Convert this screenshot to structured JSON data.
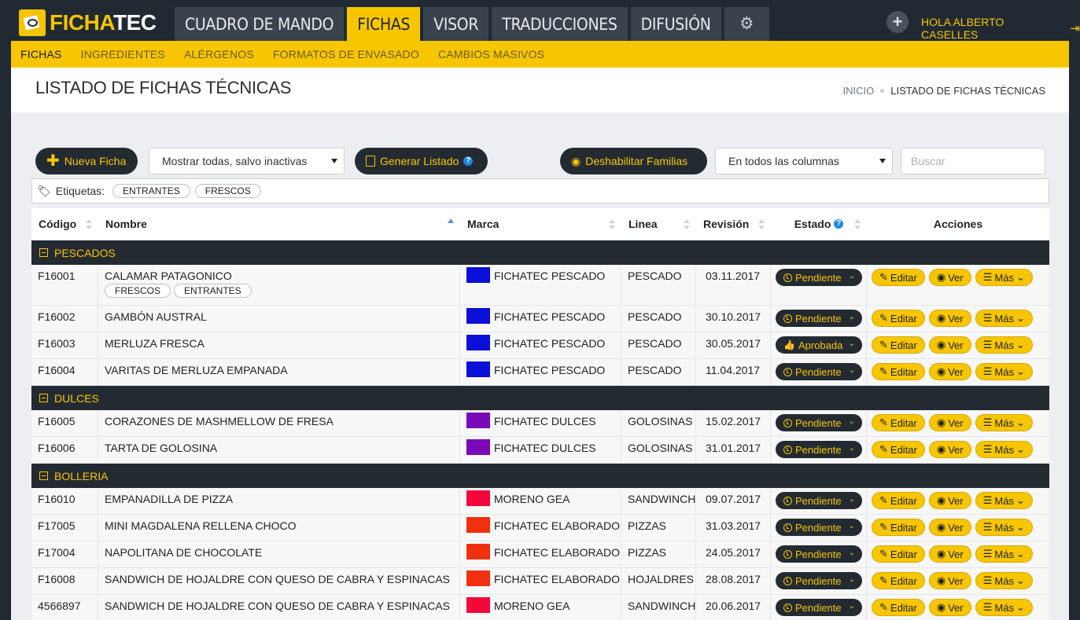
{
  "app": {
    "logo_a": "FICHA",
    "logo_b": "TEC"
  },
  "main_tabs": [
    {
      "label": "CUADRO DE MANDO"
    },
    {
      "label": "FICHAS"
    },
    {
      "label": "VISOR"
    },
    {
      "label": "TRADUCCIONES"
    },
    {
      "label": "DIFUSIÓN"
    }
  ],
  "greeting": "HOLA ALBERTO CASELLES",
  "subnav": [
    {
      "label": "FICHAS"
    },
    {
      "label": "INGREDIENTES"
    },
    {
      "label": "ALÉRGENOS"
    },
    {
      "label": "FORMATOS DE ENVASADO"
    },
    {
      "label": "CAMBIOS MASIVOS"
    }
  ],
  "page": {
    "title": "LISTADO DE FICHAS TÉCNICAS",
    "crumb_home": "INICIO",
    "crumb_current": "LISTADO DE FICHAS TÉCNICAS"
  },
  "toolbar": {
    "new_label": "Nueva Ficha",
    "filter_value": "Mostrar todas, salvo inactivas",
    "generate_label": "Generar Listado",
    "disable_families_label": "Deshabilitar Familias",
    "columns_value": "En todos las columnas",
    "search_placeholder": "Buscar"
  },
  "tags": {
    "label": "Etiquetas:",
    "items": [
      "ENTRANTES",
      "FRESCOS"
    ]
  },
  "columns": [
    "Código",
    "Nombre",
    "Marca",
    "Linea",
    "Revisión",
    "Estado",
    "Acciones"
  ],
  "actions": {
    "edit": "Editar",
    "view": "Ver",
    "more": "Más"
  },
  "colors": {
    "accent": "#f7c600",
    "dark": "#232a31"
  },
  "groups": [
    {
      "name": "PESCADOS",
      "rows": [
        {
          "code": "F16001",
          "name": "CALAMAR PATAGONICO",
          "tags": [
            "FRESCOS",
            "ENTRANTES"
          ],
          "brand": "FICHATEC PESCADO",
          "brand_color": "#0a10d8",
          "line": "PESCADO",
          "date": "03.11.2017",
          "status": "Pendiente"
        },
        {
          "code": "F16002",
          "name": "GAMBÓN AUSTRAL",
          "tags": [],
          "brand": "FICHATEC PESCADO",
          "brand_color": "#0a10d8",
          "line": "PESCADO",
          "date": "30.10.2017",
          "status": "Pendiente"
        },
        {
          "code": "F16003",
          "name": "MERLUZA FRESCA",
          "tags": [],
          "brand": "FICHATEC PESCADO",
          "brand_color": "#0a10d8",
          "line": "PESCADO",
          "date": "30.05.2017",
          "status": "Aprobada"
        },
        {
          "code": "F16004",
          "name": "VARITAS DE MERLUZA EMPANADA",
          "tags": [],
          "brand": "FICHATEC PESCADO",
          "brand_color": "#0a10d8",
          "line": "PESCADO",
          "date": "11.04.2017",
          "status": "Pendiente"
        }
      ]
    },
    {
      "name": "DULCES",
      "rows": [
        {
          "code": "F16005",
          "name": "CORAZONES DE MASHMELLOW DE FRESA",
          "tags": [],
          "brand": "FICHATEC DULCES",
          "brand_color": "#7a0ab8",
          "line": "GOLOSINAS",
          "date": "15.02.2017",
          "status": "Pendiente"
        },
        {
          "code": "F16006",
          "name": "TARTA DE GOLOSINA",
          "tags": [],
          "brand": "FICHATEC DULCES",
          "brand_color": "#7a0ab8",
          "line": "GOLOSINAS",
          "date": "31.01.2017",
          "status": "Pendiente"
        }
      ]
    },
    {
      "name": "BOLLERIA",
      "rows": [
        {
          "code": "F16010",
          "name": "EMPANADILLA DE PIZZA",
          "tags": [],
          "brand": "MORENO GEA",
          "brand_color": "#f4083c",
          "line": "SANDWINCH",
          "date": "09.07.2017",
          "status": "Pendiente"
        },
        {
          "code": "F17005",
          "name": "MINI MAGDALENA RELLENA CHOCO",
          "tags": [],
          "brand": "FICHATEC ELABORADO",
          "brand_color": "#f0300e",
          "line": "PIZZAS",
          "date": "31.03.2017",
          "status": "Pendiente"
        },
        {
          "code": "F17004",
          "name": "NAPOLITANA DE CHOCOLATE",
          "tags": [],
          "brand": "FICHATEC ELABORADO",
          "brand_color": "#f0300e",
          "line": "PIZZAS",
          "date": "24.05.2017",
          "status": "Pendiente"
        },
        {
          "code": "F16008",
          "name": "SANDWICH DE HOJALDRE CON QUESO DE CABRA Y ESPINACAS",
          "tags": [],
          "brand": "FICHATEC ELABORADO",
          "brand_color": "#f0300e",
          "line": "HOJALDRES",
          "date": "28.08.2017",
          "status": "Pendiente"
        },
        {
          "code": "4566897",
          "name": "SANDWICH DE HOJALDRE CON QUESO DE CABRA Y ESPINACAS",
          "tags": [],
          "brand": "MORENO GEA",
          "brand_color": "#f4083c",
          "line": "SANDWINCH",
          "date": "20.06.2017",
          "status": "Pendiente"
        }
      ]
    }
  ]
}
